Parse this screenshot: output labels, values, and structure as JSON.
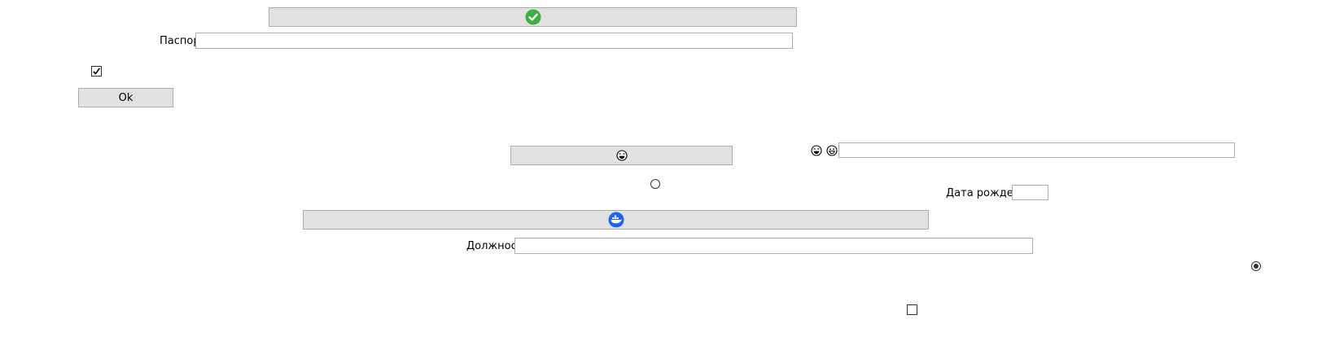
{
  "top_button": {
    "icon": "green-checkmark-icon",
    "accent": "#3cb043"
  },
  "passport": {
    "label": "Паспорт",
    "value": ""
  },
  "top_checkbox": {
    "checked": true
  },
  "ok_button": {
    "label": "Ok"
  },
  "emoji_button": {
    "icon": "laughing-face-icon"
  },
  "emoji_row": {
    "icons": [
      "laughing-face-icon",
      "grinning-face-icon"
    ],
    "value": ""
  },
  "middle_radio": {
    "selected": false
  },
  "birth_date": {
    "label": "Дата рождения",
    "value": ""
  },
  "docker_button": {
    "icon": "docker-whale-icon",
    "accent": "#1d63ed"
  },
  "position": {
    "label": "Должность",
    "value": ""
  },
  "right_radio": {
    "selected": true
  },
  "bottom_checkbox": {
    "checked": false
  }
}
